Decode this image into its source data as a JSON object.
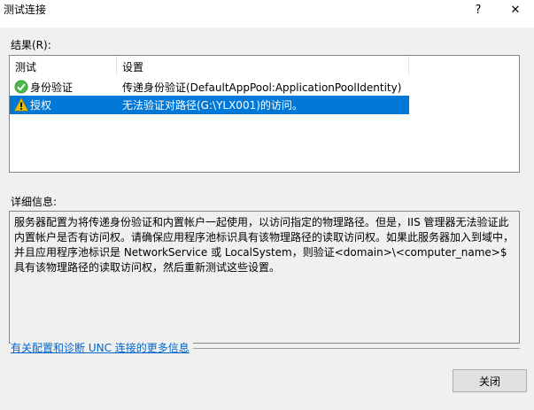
{
  "window": {
    "title": "测试连接",
    "help_glyph": "?",
    "close_glyph": "✕"
  },
  "results": {
    "label": "结果(R):",
    "columns": [
      "测试",
      "设置"
    ],
    "rows": [
      {
        "name": "身份验证",
        "setting": "传递身份验证(DefaultAppPool:ApplicationPoolIdentity)",
        "status_icon": "success-check-icon",
        "selected": false
      },
      {
        "name": "授权",
        "setting": "无法验证对路径(G:\\YLX001)的访问。",
        "status_icon": "warning-icon",
        "selected": true
      }
    ]
  },
  "details": {
    "label": "详细信息:",
    "text": "服务器配置为将传递身份验证和内置帐户一起使用，以访问指定的物理路径。但是，IIS 管理器无法验证此内置帐户是否有访问权。请确保应用程序池标识具有该物理路径的读取访问权。如果此服务器加入到域中，并且应用程序池标识是 NetworkService 或 LocalSystem，则验证<domain>\\<computer_name>$ 具有该物理路径的读取访问权，然后重新测试这些设置。"
  },
  "link": {
    "text": "有关配置和诊断 UNC 连接的更多信息"
  },
  "buttons": {
    "close": "关闭"
  },
  "colors": {
    "selection": "#0078d7",
    "link": "#0066cc",
    "success": "#3a9a3a",
    "warning": "#e8c000"
  }
}
